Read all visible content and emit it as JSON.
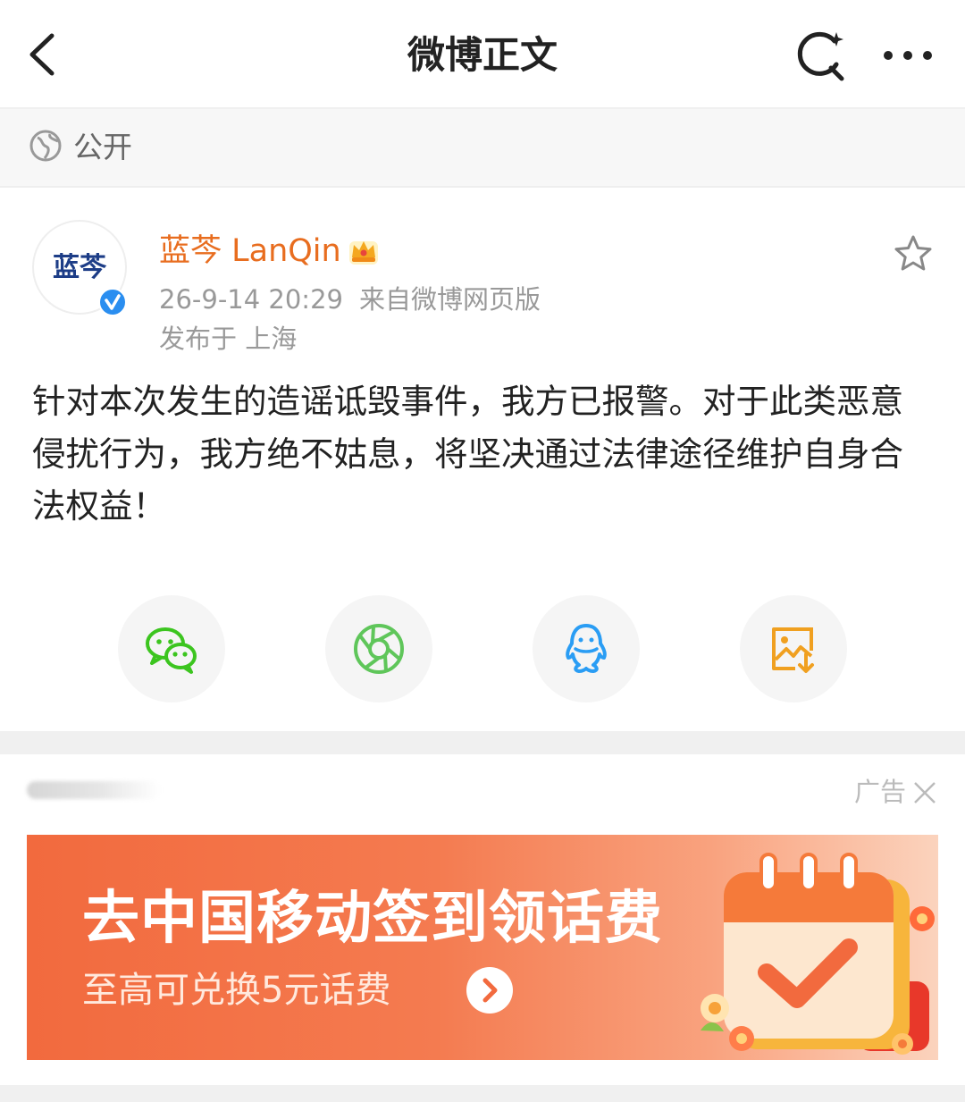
{
  "nav": {
    "title": "微博正文"
  },
  "visibility": {
    "label": "公开"
  },
  "post": {
    "avatar_text": "蓝芩",
    "author": "蓝芩 LanQin",
    "time": "26-9-14 20:29",
    "source": "来自微博网页版",
    "location": "发布于 上海",
    "content": "针对本次发生的造谣诋毁事件，我方已报警。对于此类恶意侵扰行为，我方绝不姑息，将坚决通过法律途径维护自身合法权益！"
  },
  "share": [
    {
      "icon": "wechat-icon",
      "color": "#3cc51f"
    },
    {
      "icon": "moments-icon",
      "color": "#5fc65a"
    },
    {
      "icon": "qq-icon",
      "color": "#2a9df4"
    },
    {
      "icon": "save-image-icon",
      "color": "#f0a020"
    }
  ],
  "ad": {
    "label": "广告",
    "headline": "去中国移动签到领话费",
    "subline": "至高可兑换5元话费"
  },
  "colors": {
    "author": "#e86d1f",
    "verified": "#2a8ef0",
    "ad_banner": "#f26a3e"
  }
}
